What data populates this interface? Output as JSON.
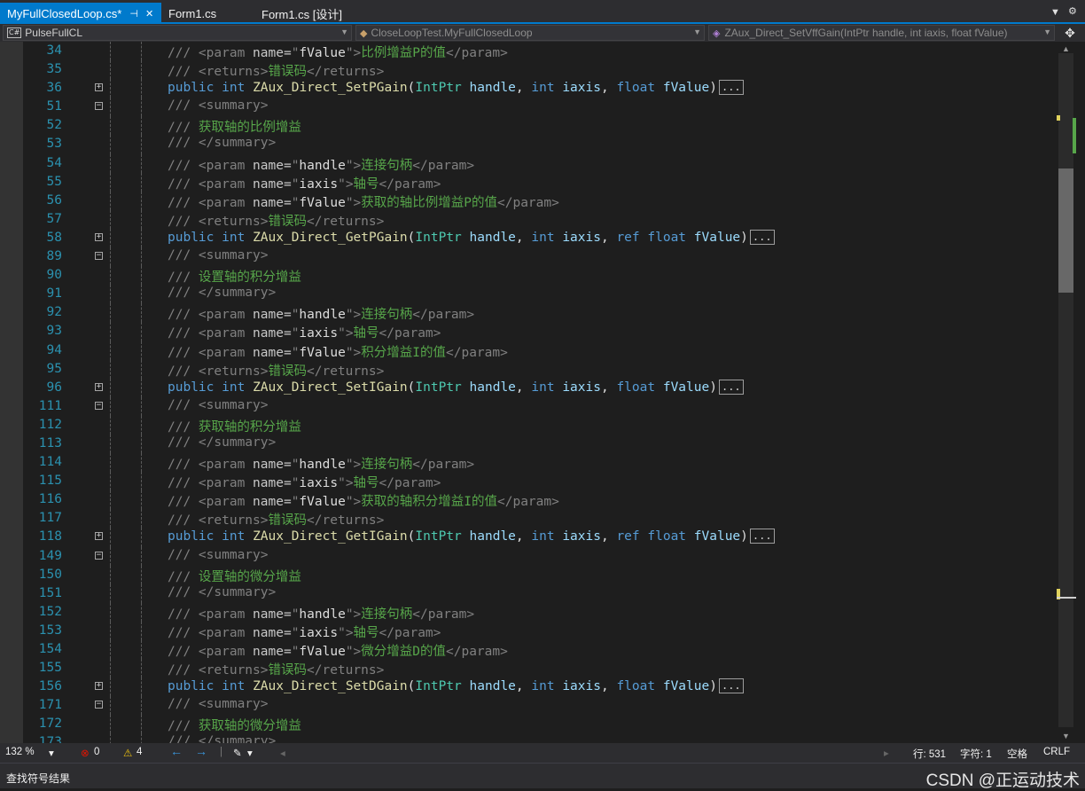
{
  "tabs": {
    "active_label": "MyFullClosedLoop.cs*",
    "pin_icon": "⊣",
    "close_icon": "✕",
    "tab2_label": "Form1.cs",
    "tab3_label": "Form1.cs [设计]"
  },
  "nav": {
    "project": "PulseFullCL",
    "class": "CloseLoopTest.MyFullClosedLoop",
    "member": "ZAux_Direct_SetVffGain(IntPtr handle, int iaxis, float fValue)"
  },
  "status": {
    "zoom": "132 %",
    "errors": "0",
    "warnings": "4",
    "line": "行: 531",
    "char": "字符: 1",
    "space": "空格",
    "eol": "CRLF"
  },
  "bottom": {
    "find_results": "查找符号结果",
    "watermark": "CSDN @正运动技术"
  },
  "colors": {
    "accent": "#007acc",
    "comment": "#57a64a",
    "keyword": "#569cd6",
    "type": "#4ec9b0",
    "method": "#dcdcaa",
    "line_number": "#2b91af"
  },
  "lines": [
    {
      "n": "34",
      "t": "param",
      "name": "fValue",
      "text": "比例增益P的值"
    },
    {
      "n": "35",
      "t": "returns",
      "text": "错误码"
    },
    {
      "n": "36",
      "t": "sig",
      "fn": "ZAux_Direct_SetPGain",
      "ref": false
    },
    {
      "n": "51",
      "t": "summary_open"
    },
    {
      "n": "52",
      "t": "text",
      "text": "获取轴的比例增益"
    },
    {
      "n": "53",
      "t": "summary_close"
    },
    {
      "n": "54",
      "t": "param",
      "name": "handle",
      "text": "连接句柄"
    },
    {
      "n": "55",
      "t": "param",
      "name": "iaxis",
      "text": "轴号"
    },
    {
      "n": "56",
      "t": "param",
      "name": "fValue",
      "text": "获取的轴比例增益P的值"
    },
    {
      "n": "57",
      "t": "returns",
      "text": "错误码"
    },
    {
      "n": "58",
      "t": "sig",
      "fn": "ZAux_Direct_GetPGain",
      "ref": true
    },
    {
      "n": "89",
      "t": "summary_open"
    },
    {
      "n": "90",
      "t": "text",
      "text": "设置轴的积分增益"
    },
    {
      "n": "91",
      "t": "summary_close"
    },
    {
      "n": "92",
      "t": "param",
      "name": "handle",
      "text": "连接句柄"
    },
    {
      "n": "93",
      "t": "param",
      "name": "iaxis",
      "text": "轴号"
    },
    {
      "n": "94",
      "t": "param",
      "name": "fValue",
      "text": "积分增益I的值"
    },
    {
      "n": "95",
      "t": "returns",
      "text": "错误码"
    },
    {
      "n": "96",
      "t": "sig",
      "fn": "ZAux_Direct_SetIGain",
      "ref": false
    },
    {
      "n": "111",
      "t": "summary_open"
    },
    {
      "n": "112",
      "t": "text",
      "text": "获取轴的积分增益"
    },
    {
      "n": "113",
      "t": "summary_close"
    },
    {
      "n": "114",
      "t": "param",
      "name": "handle",
      "text": "连接句柄"
    },
    {
      "n": "115",
      "t": "param",
      "name": "iaxis",
      "text": "轴号"
    },
    {
      "n": "116",
      "t": "param",
      "name": "fValue",
      "text": "获取的轴积分增益I的值"
    },
    {
      "n": "117",
      "t": "returns",
      "text": "错误码"
    },
    {
      "n": "118",
      "t": "sig",
      "fn": "ZAux_Direct_GetIGain",
      "ref": true
    },
    {
      "n": "149",
      "t": "summary_open"
    },
    {
      "n": "150",
      "t": "text",
      "text": "设置轴的微分增益"
    },
    {
      "n": "151",
      "t": "summary_close"
    },
    {
      "n": "152",
      "t": "param",
      "name": "handle",
      "text": "连接句柄"
    },
    {
      "n": "153",
      "t": "param",
      "name": "iaxis",
      "text": "轴号"
    },
    {
      "n": "154",
      "t": "param",
      "name": "fValue",
      "text": "微分增益D的值"
    },
    {
      "n": "155",
      "t": "returns",
      "text": "错误码"
    },
    {
      "n": "156",
      "t": "sig",
      "fn": "ZAux_Direct_SetDGain",
      "ref": false
    },
    {
      "n": "171",
      "t": "summary_open"
    },
    {
      "n": "172",
      "t": "text",
      "text": "获取轴的微分增益"
    },
    {
      "n": "173",
      "t": "summary_close"
    }
  ]
}
